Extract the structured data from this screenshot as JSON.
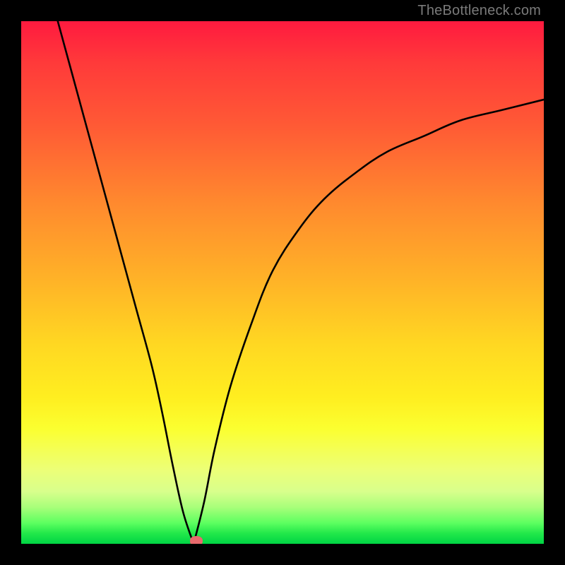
{
  "watermark": "TheBottleneck.com",
  "colors": {
    "frame": "#000000",
    "curve_stroke": "#000000",
    "marker_fill": "#e86a6d"
  },
  "chart_data": {
    "type": "line",
    "title": "",
    "xlabel": "",
    "ylabel": "",
    "xlim": [
      0,
      100
    ],
    "ylim": [
      0,
      100
    ],
    "grid": false,
    "legend": false,
    "annotations": [],
    "series": [
      {
        "name": "left-branch",
        "x": [
          7,
          10,
          13,
          16,
          19,
          22,
          25,
          27,
          29,
          31,
          33
        ],
        "y": [
          100,
          89,
          78,
          67,
          56,
          45,
          34,
          25,
          15,
          6,
          0
        ]
      },
      {
        "name": "right-branch",
        "x": [
          33,
          35,
          37,
          40,
          44,
          48,
          53,
          58,
          64,
          70,
          77,
          84,
          92,
          100
        ],
        "y": [
          0,
          8,
          18,
          30,
          42,
          52,
          60,
          66,
          71,
          75,
          78,
          81,
          83,
          85
        ]
      }
    ],
    "marker": {
      "x": 33.5,
      "y": 0.5
    },
    "background": {
      "type": "vertical-gradient",
      "stops": [
        {
          "pos": 0.0,
          "color": "#ff1a3f"
        },
        {
          "pos": 0.5,
          "color": "#ffb427"
        },
        {
          "pos": 0.8,
          "color": "#f4ff55"
        },
        {
          "pos": 1.0,
          "color": "#00d444"
        }
      ]
    }
  }
}
